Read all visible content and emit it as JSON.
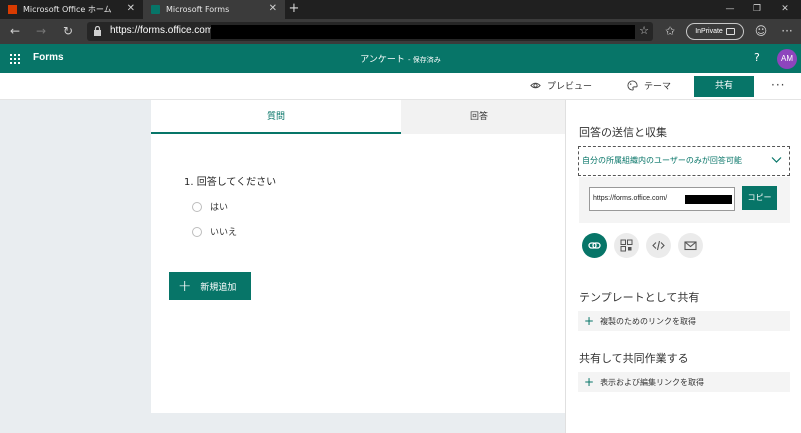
{
  "browser": {
    "tabs": [
      {
        "title": "Microsoft Office ホーム",
        "icon": "office-icon"
      },
      {
        "title": "Microsoft Forms",
        "icon": "forms-icon",
        "active": true
      }
    ],
    "new_tab": "+",
    "url": "https://forms.office.com/",
    "inprivate_label": "InPrivate"
  },
  "app": {
    "name": "Forms",
    "doc_title": "アンケート",
    "saved_status": "- 保存済み",
    "help": "?",
    "avatar_initials": "AM",
    "brand_color": "#077568"
  },
  "commands": {
    "preview": "プレビュー",
    "theme": "テーマ",
    "share": "共有",
    "more": "···"
  },
  "form": {
    "tabs": {
      "questions": "質問",
      "responses": "回答"
    },
    "question": "1. 回答してください",
    "options": [
      "はい",
      "いいえ"
    ],
    "add_new": "新規追加"
  },
  "share_panel": {
    "send_heading": "回答の送信と収集",
    "audience": "自分の所属組織内のユーザーのみが回答可能",
    "link_text": "https://forms.office.com/",
    "copy": "コピー",
    "share_icons": [
      "link-icon",
      "qr-code-icon",
      "embed-icon",
      "email-icon"
    ],
    "template_heading": "テンプレートとして共有",
    "template_action": "複製のためのリンクを取得",
    "collab_heading": "共有して共同作業する",
    "collab_action": "表示および編集リンクを取得"
  }
}
